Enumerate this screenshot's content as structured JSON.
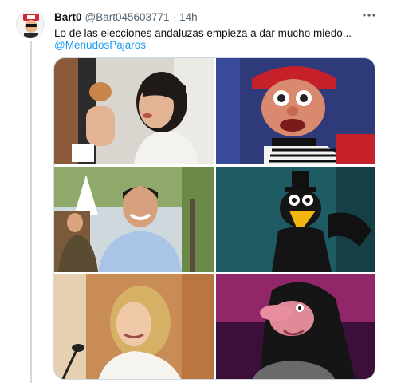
{
  "tweet": {
    "author_name": "Bart0",
    "author_handle": "@Bart045603771",
    "separator": "·",
    "time": "14h",
    "text": "Lo de las elecciones andaluzas empieza a dar mucho miedo...",
    "mention": "@MenudosPajaros",
    "more_icon": "more-horizontal-icon"
  },
  "media": {
    "photos": [
      {
        "id": "photo-woman-eating",
        "subject": "woman eating snack"
      },
      {
        "id": "photo-puppet-red-cap",
        "subject": "puppet red cap"
      },
      {
        "id": "photo-man-smiling",
        "subject": "smiling man outdoors"
      },
      {
        "id": "photo-crow-puppet",
        "subject": "crow puppet top hat"
      },
      {
        "id": "photo-woman-microphone",
        "subject": "blonde woman at microphone"
      },
      {
        "id": "photo-witch-puppet",
        "subject": "witch puppet headscarf"
      }
    ]
  },
  "colors": {
    "link": "#1d9bf0",
    "secondary_text": "#536471",
    "border": "#cfd9de"
  }
}
